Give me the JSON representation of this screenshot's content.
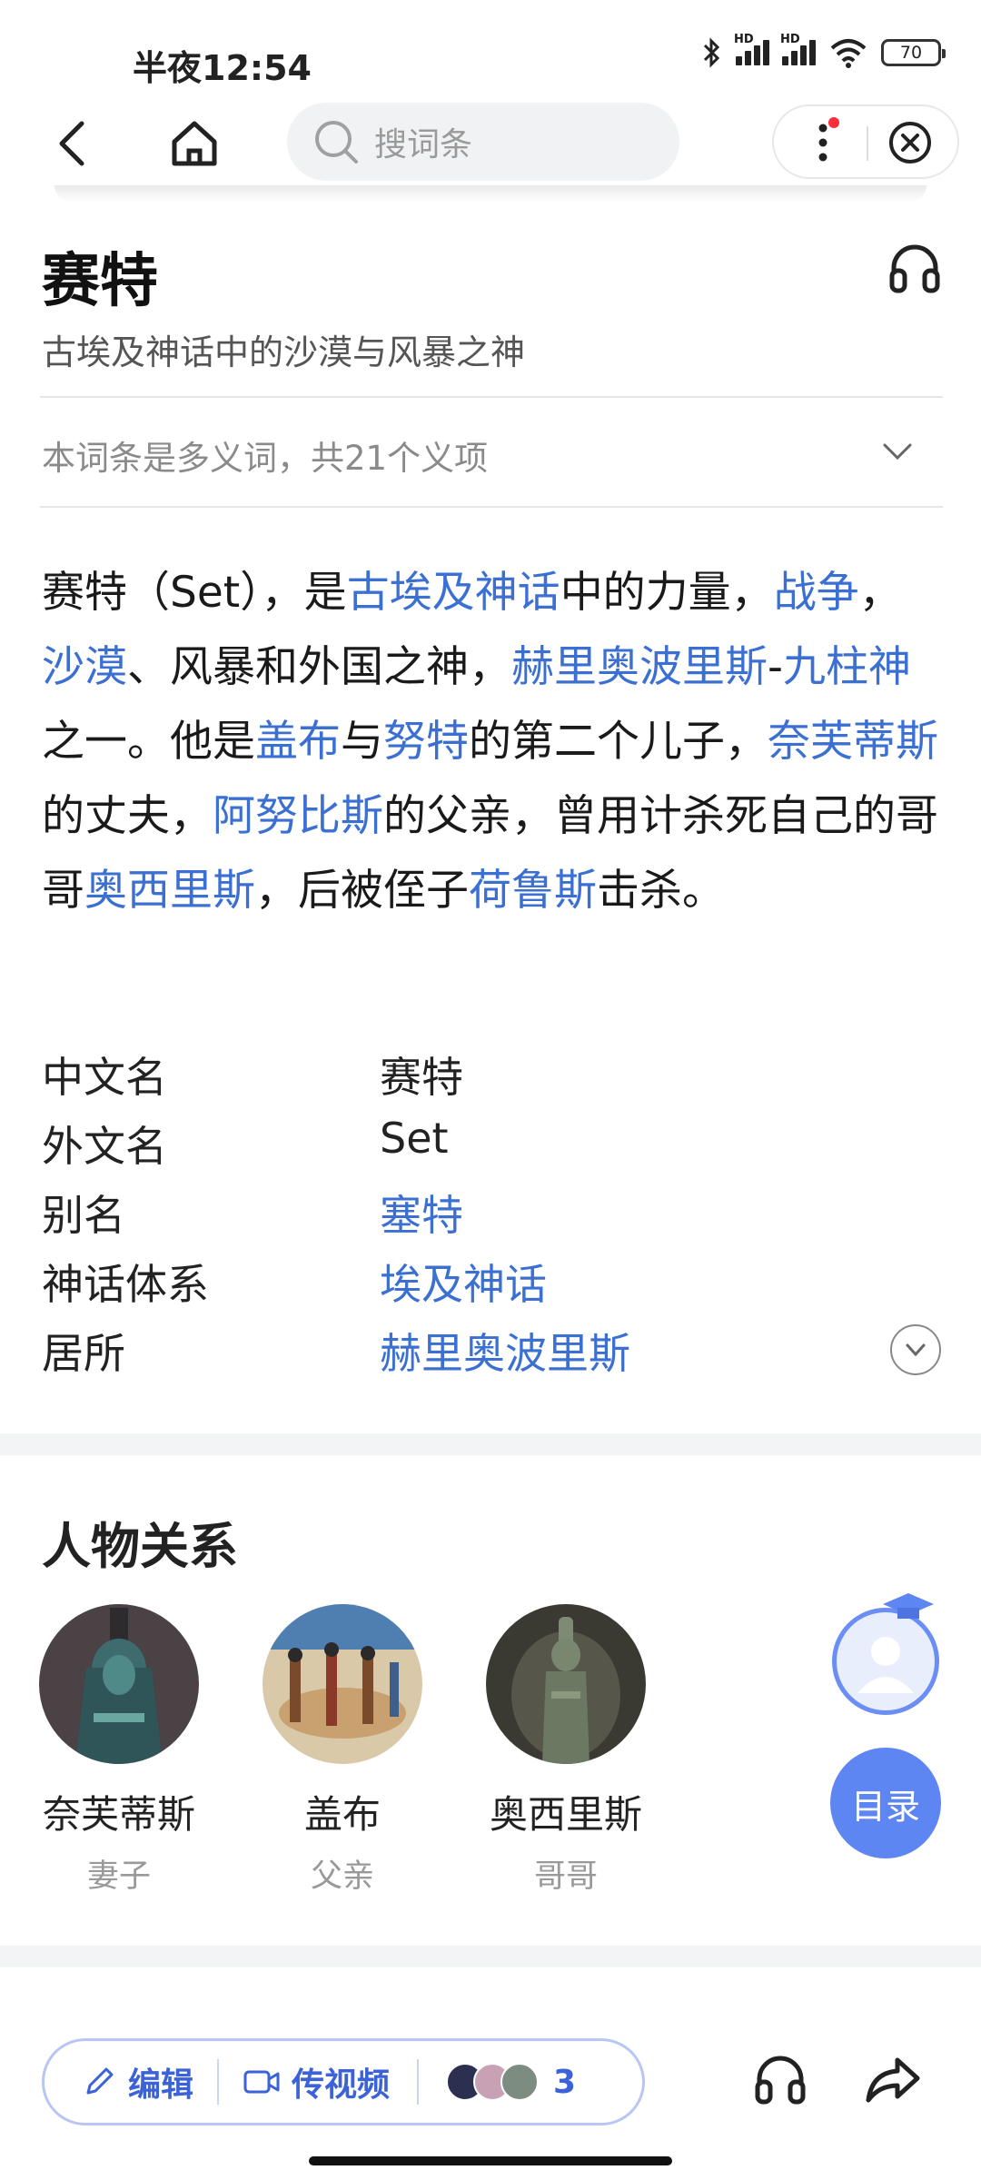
{
  "status_bar": {
    "time": "半夜12:54",
    "battery": "70",
    "hd_label": "HD"
  },
  "nav": {
    "search_placeholder": "搜词条"
  },
  "header": {
    "title": "赛特",
    "subtitle": "古埃及神话中的沙漠与风暴之神",
    "polysemy": "本词条是多义词，共21个义项"
  },
  "summary": [
    {
      "t": "赛特（Set），是"
    },
    {
      "t": "古埃及神话",
      "link": true
    },
    {
      "t": "中的力量，"
    },
    {
      "t": "战争",
      "link": true
    },
    {
      "t": "，"
    },
    {
      "t": "沙漠",
      "link": true
    },
    {
      "t": "、风暴和外国之神，"
    },
    {
      "t": "赫里奥波里斯",
      "link": true
    },
    {
      "t": "-"
    },
    {
      "t": "九柱神",
      "link": true
    },
    {
      "t": "之一。他是"
    },
    {
      "t": "盖布",
      "link": true
    },
    {
      "t": "与"
    },
    {
      "t": "努特",
      "link": true
    },
    {
      "t": "的第二个儿子，"
    },
    {
      "t": "奈芙蒂斯",
      "link": true
    },
    {
      "t": "的丈夫，"
    },
    {
      "t": "阿努比斯",
      "link": true
    },
    {
      "t": "的父亲，曾用计杀死自己的哥哥"
    },
    {
      "t": "奥西里斯",
      "link": true
    },
    {
      "t": "，后被侄子"
    },
    {
      "t": "荷鲁斯",
      "link": true
    },
    {
      "t": "击杀。"
    }
  ],
  "infobox": [
    {
      "label": "中文名",
      "value": "赛特",
      "link": false
    },
    {
      "label": "外文名",
      "value": "Set",
      "link": false
    },
    {
      "label": "别名",
      "value": "塞特",
      "link": true
    },
    {
      "label": "神话体系",
      "value": "埃及神话",
      "link": true
    },
    {
      "label": "居所",
      "value": "赫里奥波里斯",
      "link": true
    }
  ],
  "relations": {
    "title": "人物关系",
    "items": [
      {
        "name": "奈芙蒂斯",
        "role": "妻子"
      },
      {
        "name": "盖布",
        "role": "父亲"
      },
      {
        "name": "奥西里斯",
        "role": "哥哥"
      }
    ]
  },
  "toc_label": "目录",
  "bottom_bar": {
    "edit": "编辑",
    "upload_video": "传视频",
    "contributors_count": "3"
  },
  "colors": {
    "link": "#3b6fd1",
    "accent": "#5e86f3"
  }
}
